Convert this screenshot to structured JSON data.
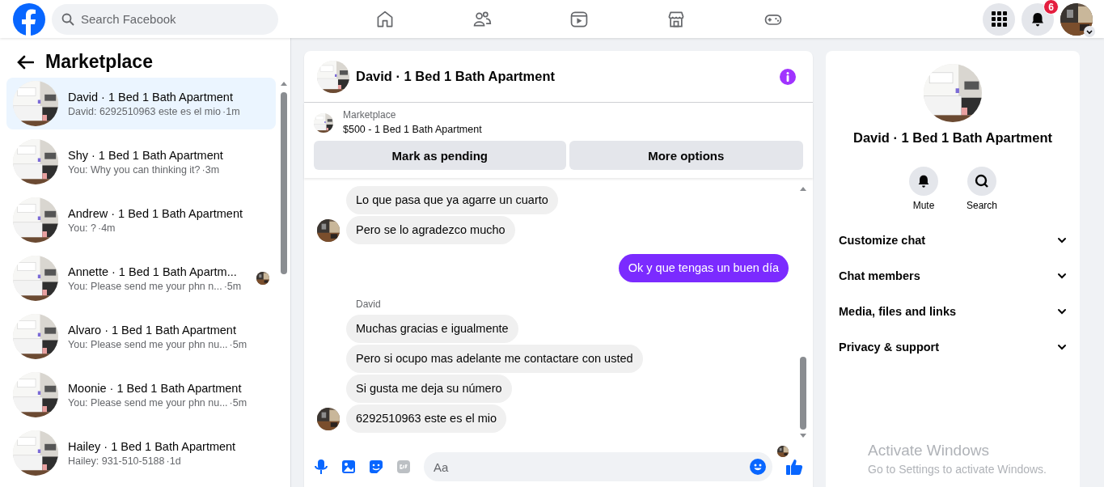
{
  "top_bar": {
    "search": {
      "placeholder": "Search Facebook"
    },
    "notification_count": "6"
  },
  "sidebar": {
    "title": "Marketplace",
    "conversations": [
      {
        "name": "David · 1 Bed 1 Bath Apartment",
        "preview": "David: 6292510963 este es el mio",
        "time": "·1m",
        "selected": true,
        "seen_avatar": false
      },
      {
        "name": "Shy · 1 Bed 1 Bath Apartment",
        "preview": "You: Why you can thinking it?",
        "time": "·3m",
        "selected": false,
        "seen_avatar": false
      },
      {
        "name": "Andrew · 1 Bed 1 Bath Apartment",
        "preview": "You: ?",
        "time": "·4m",
        "selected": false,
        "seen_avatar": false
      },
      {
        "name": "Annette · 1 Bed 1 Bath Apartm...",
        "preview": "You: Please send me your phn n...",
        "time": "·5m",
        "selected": false,
        "seen_avatar": true
      },
      {
        "name": "Alvaro · 1 Bed 1 Bath Apartment",
        "preview": "You: Please send me your phn nu...",
        "time": "·5m",
        "selected": false,
        "seen_avatar": false
      },
      {
        "name": "Moonie · 1 Bed 1 Bath Apartment",
        "preview": "You: Please send me your phn nu...",
        "time": "·5m",
        "selected": false,
        "seen_avatar": false
      },
      {
        "name": "Hailey · 1 Bed 1 Bath Apartment",
        "preview": "Hailey: 931-510-5188",
        "time": "·1d",
        "selected": false,
        "seen_avatar": false
      }
    ]
  },
  "chat": {
    "title": "David · 1 Bed 1 Bath Apartment",
    "listing": {
      "label": "Marketplace",
      "item": "$500 - 1 Bed 1 Bath Apartment",
      "buttons": [
        "Mark as pending",
        "More options"
      ]
    },
    "messages": [
      {
        "kind": "incoming",
        "text": "Lo que  pasa que ya agarre un cuarto",
        "avatar": false
      },
      {
        "kind": "incoming",
        "text": "Pero se lo agradezco mucho",
        "avatar": true
      },
      {
        "kind": "outgoing",
        "text": "Ok y que tengas un buen día"
      },
      {
        "kind": "sender",
        "text": "David"
      },
      {
        "kind": "incoming",
        "text": "Muchas gracias e igualmente",
        "avatar": false
      },
      {
        "kind": "incoming",
        "text": "Pero si ocupo mas adelante me contactare con usted",
        "avatar": false
      },
      {
        "kind": "incoming",
        "text": "Si gusta me deja su número",
        "avatar": false
      },
      {
        "kind": "incoming",
        "text": "6292510963 este es el mio",
        "avatar": true
      }
    ],
    "composer": {
      "placeholder": "Aa"
    }
  },
  "details": {
    "title": "David · 1 Bed 1 Bath Apartment",
    "actions": [
      "Mute",
      "Search"
    ],
    "sections": [
      {
        "label": "Customize chat",
        "expanded": false
      },
      {
        "label": "Chat members",
        "expanded": false
      },
      {
        "label": "Media, files and links",
        "expanded": false
      },
      {
        "label": "Privacy & support",
        "expanded": false
      }
    ]
  },
  "os_overlay": {
    "title": "Activate Windows",
    "text": "Go to Settings to activate Windows."
  }
}
